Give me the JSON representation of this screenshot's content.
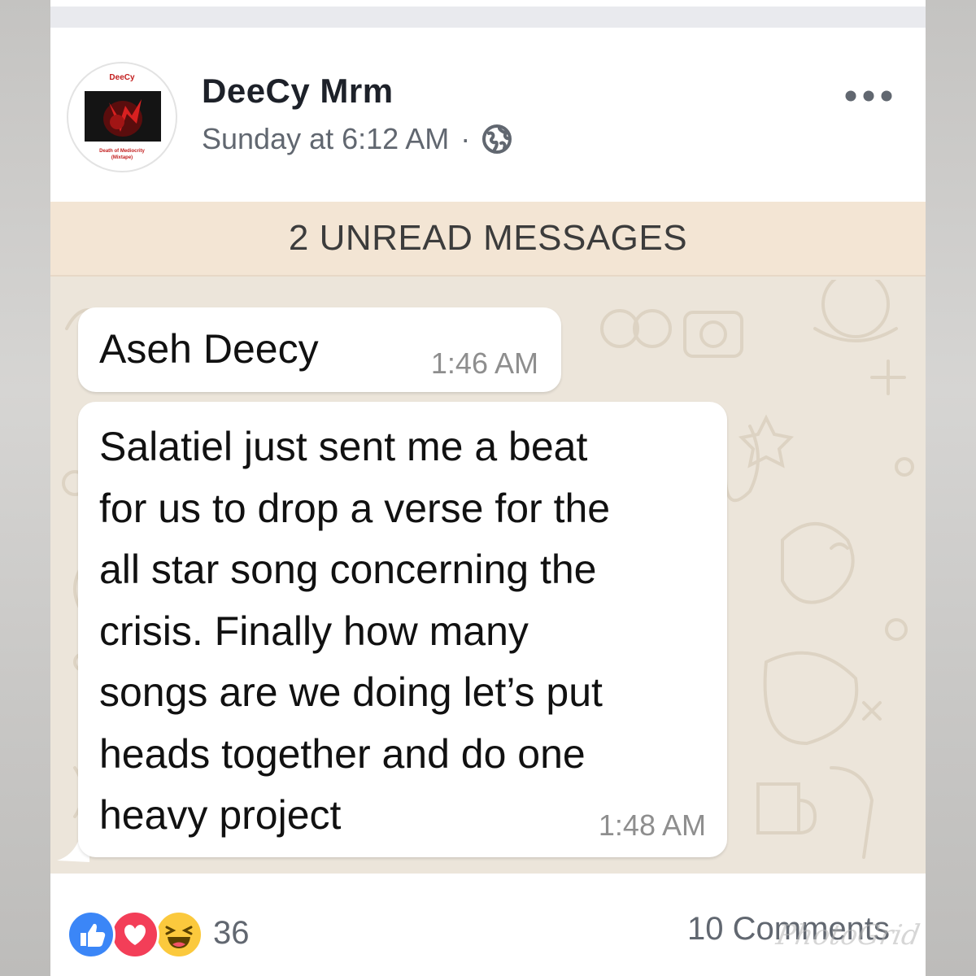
{
  "post": {
    "author": "DeeCy Mrm",
    "timestamp": "Sunday at 6:12 AM",
    "separator": "·",
    "privacy_icon": "globe-icon",
    "more_icon": "more-options-icon",
    "avatar": {
      "logo_title": "DeeCy",
      "logo_subtitle_1": "Death of Mediocrity",
      "logo_subtitle_2": "(Mixtape)"
    }
  },
  "chat_screenshot": {
    "unread_banner": "2 UNREAD MESSAGES",
    "messages": [
      {
        "text": "Aseh Deecy",
        "time": "1:46 AM"
      },
      {
        "text": "Salatiel just sent me a beat\nfor us to drop a verse for the\nall star song concerning the\ncrisis. Finally how many\nsongs are we doing let’s put\nheads together and do one\nheavy project",
        "time": "1:48 AM"
      }
    ],
    "bubble_color": "#ffffff",
    "background_color": "#ece5da"
  },
  "footer": {
    "reactions": [
      "like-icon",
      "love-icon",
      "haha-icon"
    ],
    "reaction_count": "36",
    "comments": "10 Comments"
  },
  "watermark": "PhotoGrid",
  "colors": {
    "like": "#3b86f7",
    "love": "#f33e58",
    "haha": "#fbc93d",
    "banner": "#f3e5d4"
  }
}
